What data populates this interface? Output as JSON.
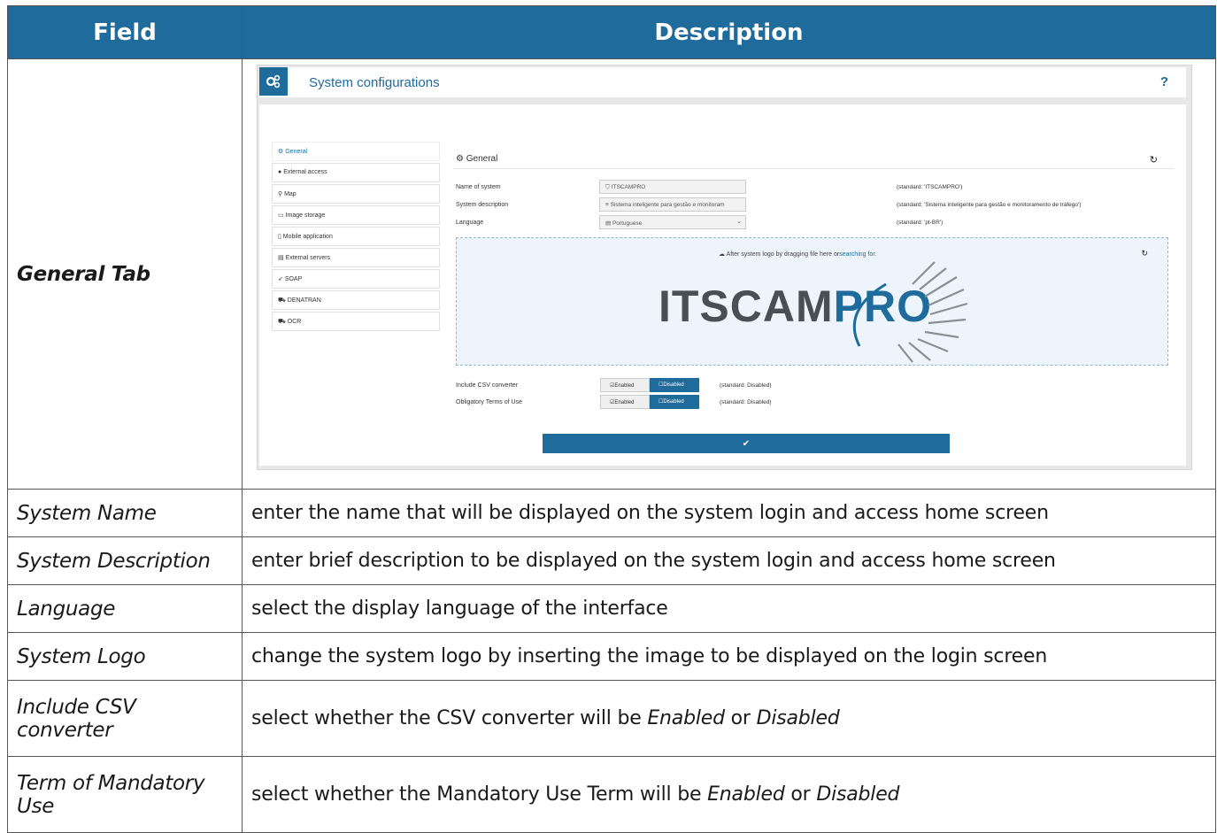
{
  "table": {
    "header_field": "Field",
    "header_description": "Description",
    "rows": [
      {
        "field": "General Tab"
      },
      {
        "field": "System Name",
        "description": "enter the name that will be displayed on the system login and access home screen"
      },
      {
        "field": "System Description",
        "description": "enter brief description to be displayed on the system login and access home screen"
      },
      {
        "field": "Language",
        "description": "select the display language of the interface"
      },
      {
        "field": "System Logo",
        "description": "change the system logo by inserting the image to be displayed on the login screen"
      },
      {
        "field": "Include CSV converter",
        "desc_prefix": "select whether the CSV converter will be ",
        "desc_enabled": "Enabled",
        "desc_or": " or ",
        "desc_disabled": "Disabled"
      },
      {
        "field": "Term of Mandatory Use",
        "desc_prefix": "select whether the Mandatory Use Term will be ",
        "desc_enabled": "Enabled",
        "desc_or": " or ",
        "desc_disabled": "Disabled"
      }
    ]
  },
  "screenshot": {
    "title": "System configurations",
    "help": "?",
    "sidebar": [
      "General",
      "External access",
      "Map",
      "Image storage",
      "Mobile application",
      "External servers",
      "SOAP",
      "DENATRAN",
      "OCR"
    ],
    "panel_title": "General",
    "fields": [
      {
        "label": "Name of system",
        "value": "ITSCAMPRO",
        "standard": "(standard: 'ITSCAMPRO')"
      },
      {
        "label": "System description",
        "value": "Sistema inteligente para gestão e monitoram",
        "standard": "(standard: 'Sistema inteligente para gestão e monitoramento de tráfego')"
      },
      {
        "label": "Language",
        "value": "Portuguese",
        "standard": "(standard: 'pt-BR')"
      }
    ],
    "drop_text": "After system logo by dragging file here or",
    "drop_link": "searching for.",
    "logo_main": "ITSCAM",
    "logo_pro": "PRO",
    "toggles": [
      {
        "label": "Include CSV converter",
        "on": "Enabled",
        "off": "Disabled",
        "standard": "(standard: Disabled)"
      },
      {
        "label": "Obligatory Terms of Use",
        "on": "Enabled",
        "off": "Disabled",
        "standard": "(standard: Disabled)"
      }
    ],
    "save_icon": "✔",
    "accent_color": "#1f6b9c"
  }
}
